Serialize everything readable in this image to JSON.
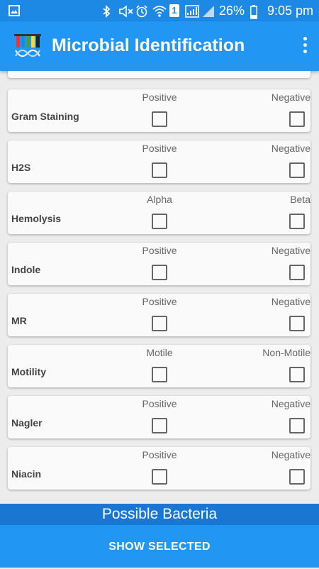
{
  "status_bar": {
    "battery": "26%",
    "time": "9:05 pm",
    "sim_slot": "1",
    "icons": [
      "image-icon",
      "bluetooth-icon",
      "mute-icon",
      "alarm-icon",
      "wifi-icon",
      "sim-icon",
      "signal-icon",
      "battery-icon"
    ]
  },
  "app_bar": {
    "title": "Microbial Identification",
    "logo_icon": "test-tubes-dna-icon",
    "menu_icon": "more-vert-icon"
  },
  "tests": [
    {
      "label": "Gram Staining",
      "option_a": "Positive",
      "option_b": "Negative"
    },
    {
      "label": "H2S",
      "option_a": "Positive",
      "option_b": "Negative"
    },
    {
      "label": "Hemolysis",
      "option_a": "Alpha",
      "option_b": "Beta"
    },
    {
      "label": "Indole",
      "option_a": "Positive",
      "option_b": "Negative"
    },
    {
      "label": "MR",
      "option_a": "Positive",
      "option_b": "Negative"
    },
    {
      "label": "Motility",
      "option_a": "Motile",
      "option_b": "Non-Motile"
    },
    {
      "label": "Nagler",
      "option_a": "Positive",
      "option_b": "Negative"
    },
    {
      "label": "Niacin",
      "option_a": "Positive",
      "option_b": "Negative"
    }
  ],
  "footer": {
    "possible_label": "Possible Bacteria",
    "show_button": "SHOW SELECTED"
  },
  "colors": {
    "status_bar": "#1e88e5",
    "app_bar": "#2196f3",
    "possible_bar": "#1976d2"
  }
}
